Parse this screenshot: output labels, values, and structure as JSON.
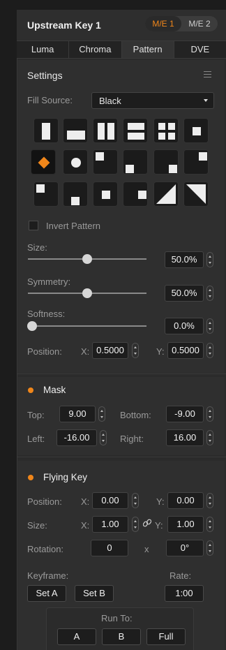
{
  "header": {
    "title": "Upstream Key 1",
    "me1": "M/E 1",
    "me2": "M/E 2"
  },
  "tabs": [
    "Luma",
    "Chroma",
    "Pattern",
    "DVE"
  ],
  "active_tab": "Pattern",
  "settings": {
    "title": "Settings",
    "fill_source_label": "Fill Source:",
    "fill_source_value": "Black",
    "invert_label": "Invert Pattern",
    "invert_checked": false,
    "size_label": "Size:",
    "size_value": "50.0%",
    "size_level": 0.5,
    "symmetry_label": "Symmetry:",
    "symmetry_value": "50.0%",
    "symmetry_level": 0.5,
    "softness_label": "Softness:",
    "softness_value": "0.0%",
    "softness_level": 0.0,
    "position_label": "Position:",
    "x_label": "X:",
    "y_label": "Y:",
    "pos_x": "0.5000",
    "pos_y": "0.5000",
    "selected_pattern": "diamond-iris"
  },
  "mask": {
    "title": "Mask",
    "top_label": "Top:",
    "top": "9.00",
    "bottom_label": "Bottom:",
    "bottom": "-9.00",
    "left_label": "Left:",
    "left": "-16.00",
    "right_label": "Right:",
    "right": "16.00"
  },
  "flying_key": {
    "title": "Flying Key",
    "position_label": "Position:",
    "pos_x": "0.00",
    "pos_y": "0.00",
    "size_label": "Size:",
    "size_x": "1.00",
    "size_y": "1.00",
    "rotation_label": "Rotation:",
    "rotation_a": "0",
    "rotation_x": "x",
    "rotation_b": "0°",
    "x_label": "X:",
    "y_label": "Y:",
    "keyframe_label": "Keyframe:",
    "set_a": "Set A",
    "set_b": "Set B",
    "rate_label": "Rate:",
    "rate": "1:00",
    "run_to_label": "Run To:",
    "run_a": "A",
    "run_b": "B",
    "run_full": "Full"
  },
  "colors": {
    "accent": "#f0861a",
    "panel": "#2b2b2b",
    "field": "#1d1d1d"
  }
}
